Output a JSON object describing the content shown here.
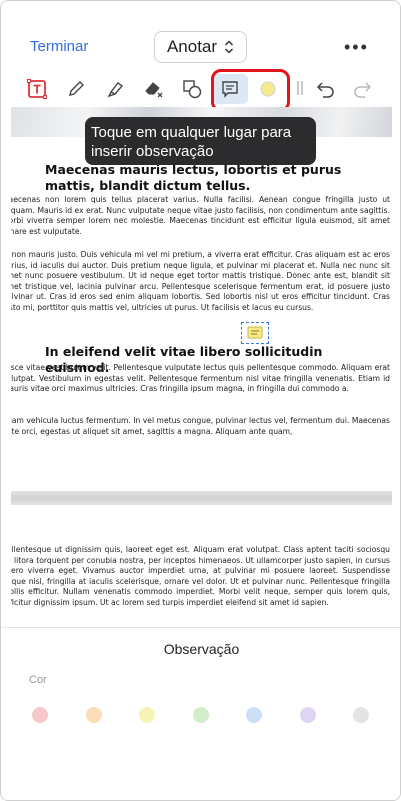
{
  "header": {
    "finish_label": "Terminar",
    "mode_label": "Anotar",
    "more_label": "•••"
  },
  "toolbar": {
    "tools": [
      "text-box-icon",
      "pencil-icon",
      "highlighter-icon",
      "eraser-icon",
      "shapes-icon",
      "note-icon",
      "color-icon",
      "undo-icon",
      "redo-icon"
    ],
    "selected_tool": "note-icon",
    "selected_color": "#f5e98a"
  },
  "tooltip": {
    "text": "Toque em qualquer lugar para inserir observação"
  },
  "document": {
    "heading1": "Maecenas mauris lectus, lobortis et purus mattis, blandit dictum tellus.",
    "p1": "Maecenas non lorem quis tellus placerat varius. Nulla facilisi. Aenean congue fringilla justo ut aliquam. Mauris id ex erat. Nunc vulputate neque vitae justo facilisis, non condimentum ante sagittis. Morbi viverra semper lorem nec molestie. Maecenas tincidunt est efficitur ligula euismod, sit amet ornare est vulputate.",
    "p2": "In non mauris justo. Duis vehicula mi vel mi pretium, a viverra erat efficitur. Cras aliquam est ac eros varius, id iaculis dui auctor. Duis pretium neque ligula, et pulvinar mi placerat et. Nulla nec nunc sit amet nunc posuere vestibulum. Ut id neque eget tortor mattis tristique. Donec ante est, blandit sit amet tristique vel, lacinia pulvinar arcu. Pellentesque scelerisque fermentum erat, id posuere justo pulvinar ut. Cras id eros sed enim aliquam lobortis. Sed lobortis nisl ut eros efficitur tincidunt. Cras justo mi, porttitor quis mattis vel, ultricies ut purus. Ut facilisis et lacus eu cursus.",
    "heading2": "In eleifend velit vitae libero sollicitudin euismod.",
    "p3": "Fusce vitae vestibulum velit. Pellentesque vulputate lectus quis pellentesque commodo. Aliquam erat volutpat. Vestibulum in egestas velit. Pellentesque fermentum nisl vitae fringilla venenatis. Etiam id mauris vitae orci maximus ultricies. Cras fringilla ipsum magna, in fringilla dui commodo a.",
    "p4": "Etiam vehicula luctus fermentum. In vel metus congue, pulvinar lectus vel, fermentum dui. Maecenas ante orci, egestas ut aliquet sit amet, sagittis a magna. Aliquam ante quam,",
    "p5": "pellentesque ut dignissim quis, laoreet eget est. Aliquam erat volutpat. Class aptent taciti sociosqu ad litora torquent per conubia nostra, per inceptos himenaeos. Ut ullamcorper justo sapien, in cursus libero viverra eget. Vivamus auctor imperdiet urna, at pulvinar mi posuere laoreet. Suspendisse neque nisl, fringilla at iaculis scelerisque, ornare vel dolor. Ut et pulvinar nunc. Pellentesque fringilla mollis efficitur. Nullam venenatis commodo imperdiet. Morbi velit neque, semper quis lorem quis, efficitur dignissim ipsum. Ut ac lorem sed turpis imperdiet eleifend sit amet id sapien."
  },
  "sheet": {
    "title": "Observação",
    "color_label": "Cor",
    "colors": [
      "#f7c7cb",
      "#fbdcb8",
      "#f6f3b4",
      "#cfeec9",
      "#cbe0f6",
      "#e0d4f4",
      "#e4e4e4"
    ]
  }
}
